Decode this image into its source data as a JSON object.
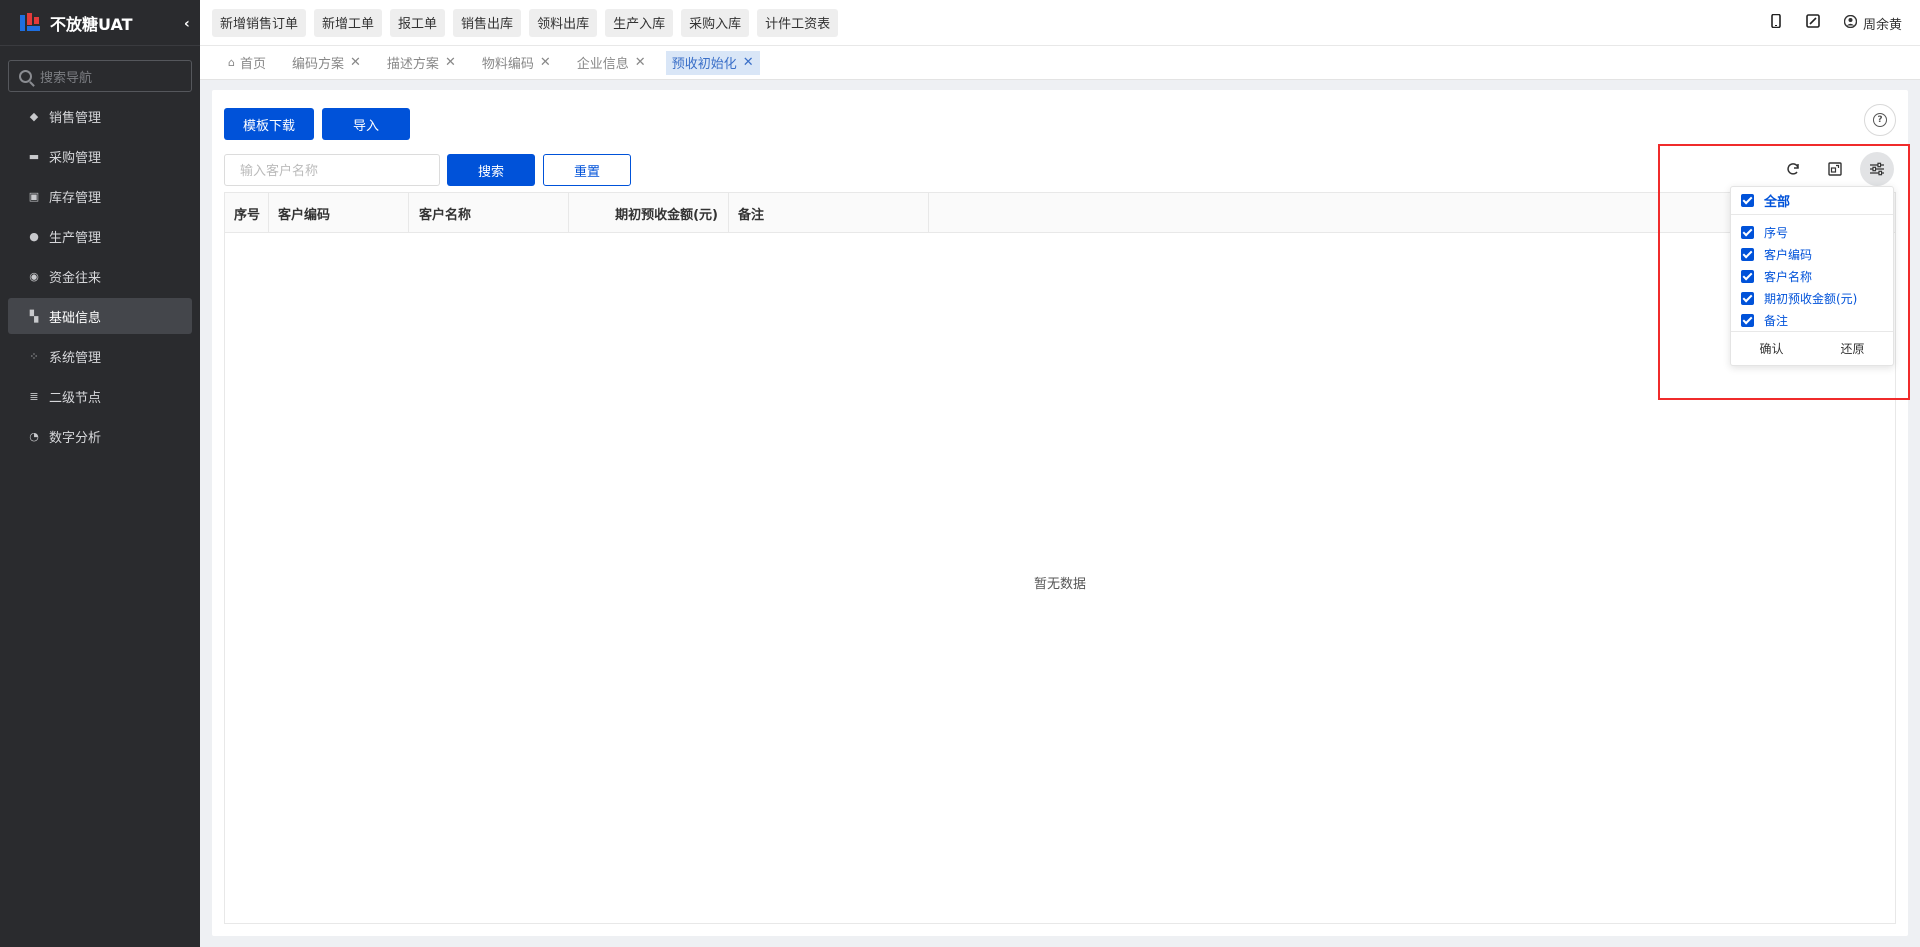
{
  "brand": {
    "title": "不放糖UAT"
  },
  "sidebar": {
    "search_placeholder": "搜索导航",
    "items": [
      {
        "label": "销售管理"
      },
      {
        "label": "采购管理"
      },
      {
        "label": "库存管理"
      },
      {
        "label": "生产管理"
      },
      {
        "label": "资金往来"
      },
      {
        "label": "基础信息",
        "active": true
      },
      {
        "label": "系统管理"
      },
      {
        "label": "二级节点"
      },
      {
        "label": "数字分析"
      }
    ]
  },
  "quick_links": [
    "新增销售订单",
    "新增工单",
    "报工单",
    "销售出库",
    "领料出库",
    "生产入库",
    "采购入库",
    "计件工资表"
  ],
  "user": {
    "name": "周余黄"
  },
  "tabs": [
    {
      "label": "首页"
    },
    {
      "label": "编码方案"
    },
    {
      "label": "描述方案"
    },
    {
      "label": "物料编码"
    },
    {
      "label": "企业信息"
    },
    {
      "label": "预收初始化",
      "active": true
    }
  ],
  "toolbar": {
    "template_download": "模板下载",
    "import": "导入",
    "search_placeholder": "输入客户名称",
    "search": "搜索",
    "reset": "重置"
  },
  "table": {
    "columns": [
      "序号",
      "客户编码",
      "客户名称",
      "期初预收金额(元)",
      "备注"
    ],
    "empty_text": "暂无数据"
  },
  "column_panel": {
    "all_label": "全部",
    "items": [
      "序号",
      "客户编码",
      "客户名称",
      "期初预收金额(元)",
      "备注"
    ],
    "confirm": "确认",
    "restore": "还原"
  },
  "colors": {
    "primary": "#0052d9",
    "sidebar_bg": "#2a2b2e",
    "highlight": "#f02b2b"
  }
}
